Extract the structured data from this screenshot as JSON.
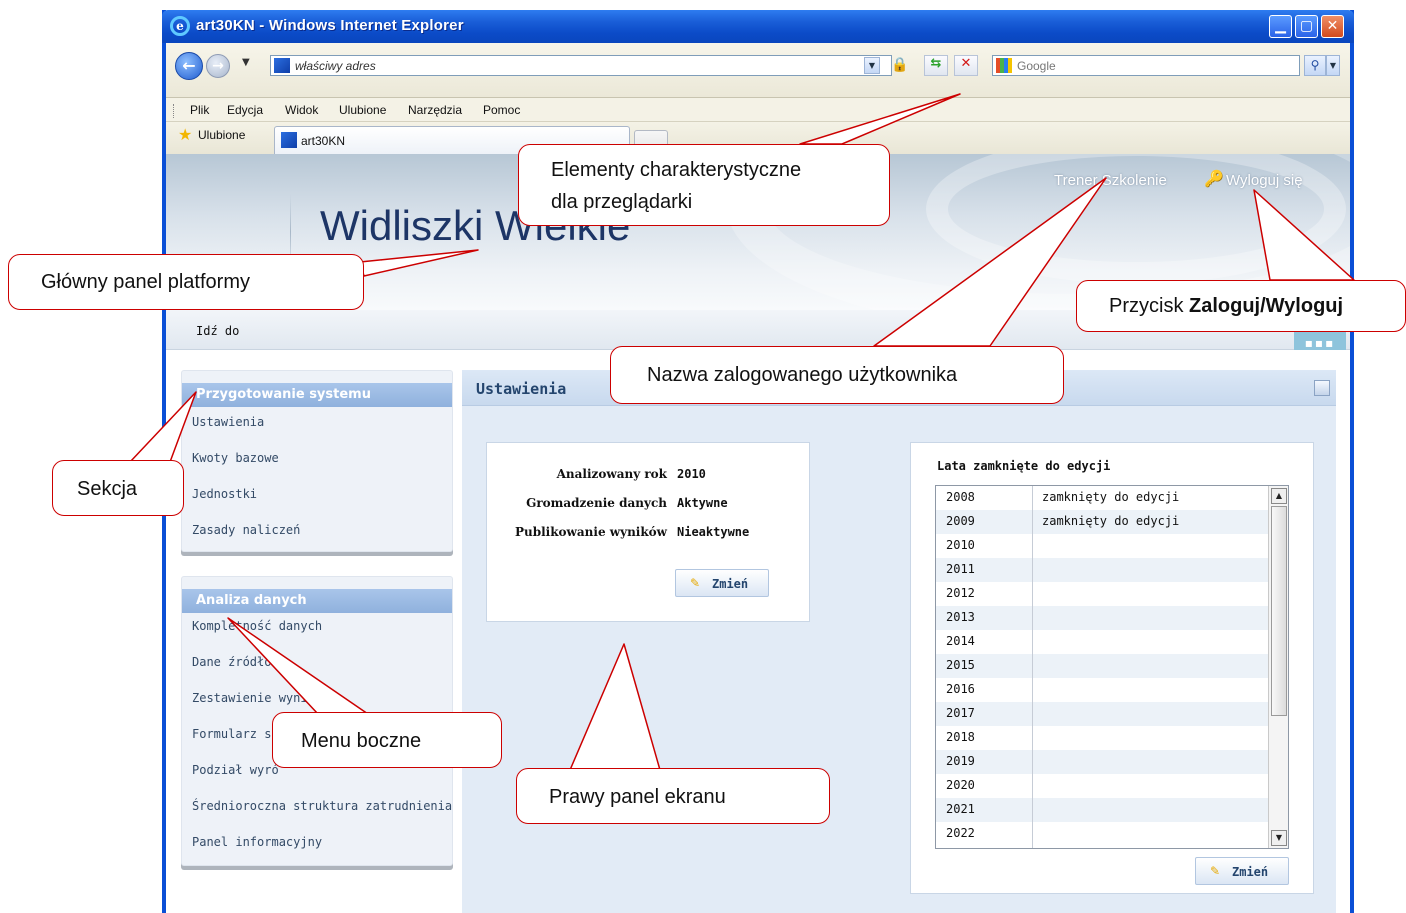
{
  "window": {
    "title": "art30KN - Windows Internet Explorer"
  },
  "browser": {
    "address": "właściwy adres",
    "search_placeholder": "Google",
    "menu": [
      "Plik",
      "Edycja",
      "Widok",
      "Ulubione",
      "Narzędzia",
      "Pomoc"
    ],
    "favorites_label": "Ulubione",
    "tab_label": "art30KN"
  },
  "header": {
    "title": "Widliszki Wielkie",
    "user_name": "Trener Szkolenie",
    "logout_label": "Wyloguj się",
    "goto_label": "Idź do"
  },
  "sidebar": {
    "sections": [
      {
        "title": "Przygotowanie systemu",
        "items": [
          "Ustawienia",
          "Kwoty bazowe",
          "Jednostki",
          "Zasady naliczeń"
        ]
      },
      {
        "title": "Analiza danych",
        "items": [
          "Kompletność danych",
          "Dane źródłowe",
          "Zestawienie wyników",
          "Formularz s",
          "Podział wyró",
          "Średnioroczna struktura zatrudnienia",
          "Panel informacyjny"
        ]
      }
    ]
  },
  "panel": {
    "title": "Ustawienia",
    "settings": [
      {
        "label": "Analizowany rok",
        "value": "2010"
      },
      {
        "label": "Gromadzenie danych",
        "value": "Aktywne"
      },
      {
        "label": "Publikowanie wyników",
        "value": "Nieaktywne"
      }
    ],
    "change_label": "Zmień",
    "closed_years_title": "Lata zamknięte do edycji",
    "years": [
      {
        "year": "2008",
        "status": "zamknięty do edycji"
      },
      {
        "year": "2009",
        "status": "zamknięty do edycji"
      },
      {
        "year": "2010",
        "status": ""
      },
      {
        "year": "2011",
        "status": ""
      },
      {
        "year": "2012",
        "status": ""
      },
      {
        "year": "2013",
        "status": ""
      },
      {
        "year": "2014",
        "status": ""
      },
      {
        "year": "2015",
        "status": ""
      },
      {
        "year": "2016",
        "status": ""
      },
      {
        "year": "2017",
        "status": ""
      },
      {
        "year": "2018",
        "status": ""
      },
      {
        "year": "2019",
        "status": ""
      },
      {
        "year": "2020",
        "status": ""
      },
      {
        "year": "2021",
        "status": ""
      },
      {
        "year": "2022",
        "status": ""
      }
    ]
  },
  "annotations": {
    "browser_elements_line1": "Elementy charakterystyczne",
    "browser_elements_line2": "dla przeglądarki",
    "main_panel": "Główny panel platformy",
    "login_button_prefix": "Przycisk ",
    "login_button_bold": "Zaloguj/Wyloguj",
    "logged_user": "Nazwa zalogowanego użytkownika",
    "section": "Sekcja",
    "side_menu": "Menu boczne",
    "right_panel": "Prawy panel ekranu"
  },
  "colors": {
    "accent": "#0a4fd6",
    "annotation_border": "#cc0000",
    "section_header": "#8fb1dd"
  }
}
